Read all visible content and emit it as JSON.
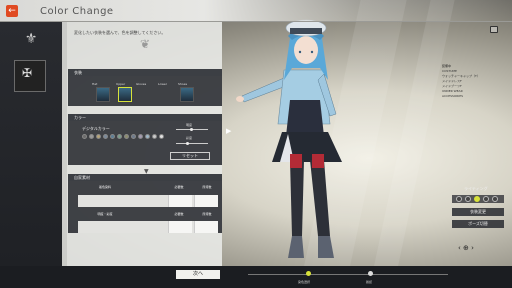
{
  "header": {
    "title": "Color Change",
    "back_icon": "back-arrow-icon"
  },
  "sidebar": {
    "caption": "",
    "emblem_icon": "crest-icon"
  },
  "panel": {
    "intro_text": "変化したい衣装を選んで、色を調整してください。",
    "outfit_section": {
      "title": "衣装",
      "tabs": [
        "Hat",
        "Upper",
        "Gloves",
        "Lower",
        "Shoes"
      ]
    },
    "color_section": {
      "title": "カラー",
      "preset_label": "デジタルカラー",
      "swatches": [
        "#6b6b6b",
        "#9a9a9a",
        "#b5a47a",
        "#7b8a9a",
        "#5d7e95",
        "#7a9e8c",
        "#8d8d6e",
        "#6e7a8b",
        "#a49bb0",
        "#9eb8c9",
        "#c9c9c9",
        "#e1e1e1"
      ],
      "slider1_label": "明度",
      "slider2_label": "彩度",
      "reset_label": "リセット"
    },
    "material_section": {
      "title": "自家素材",
      "rows": [
        {
          "name": "着色染料",
          "need": "必要数",
          "have": "所持数"
        },
        {
          "name": "明度・彩度",
          "need": "必要数",
          "have": "所持数"
        }
      ]
    }
  },
  "right_menu": {
    "title": "装備中",
    "items": [
      "COSTUME",
      "ウォッチャーキャップ（T）",
      "メイドドレスF",
      "メイドブーツF",
      "UNDER WEAR",
      "ACCESSORIES"
    ],
    "lighting_label": "ライティング",
    "btn_change_label": "衣装変更",
    "btn_pose_label": "ポーズ切替"
  },
  "footer": {
    "next_label": "次へ",
    "step1_label": "染色選択",
    "step2_label": "確認"
  },
  "colors": {
    "accent": "#d8e23a",
    "back_button": "#e04a22",
    "dark": "#1b1d21"
  }
}
